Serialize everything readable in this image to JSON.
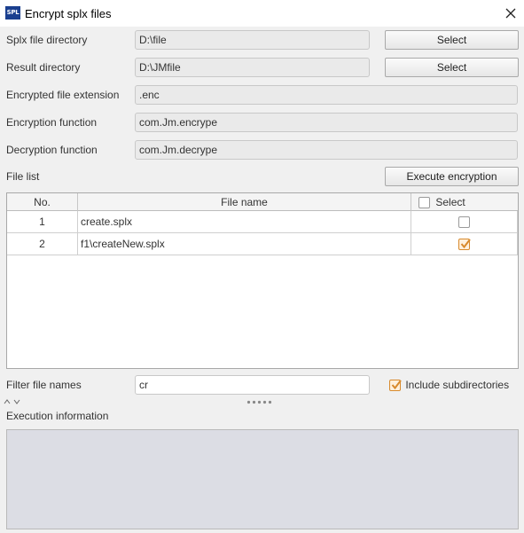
{
  "window": {
    "app_icon_text": "SPL",
    "title": "Encrypt splx files",
    "close_icon": "close-icon"
  },
  "form": {
    "splx_dir_label": "Splx file directory",
    "splx_dir_value": "D:\\file",
    "result_dir_label": "Result directory",
    "result_dir_value": "D:\\JMfile",
    "select_label": "Select",
    "ext_label": "Encrypted file extension",
    "ext_value": ".enc",
    "enc_func_label": "Encryption function",
    "enc_func_value": "com.Jm.encrype",
    "dec_func_label": "Decryption function",
    "dec_func_value": "com.Jm.decrype"
  },
  "file_list": {
    "label": "File list",
    "execute_label": "Execute encryption",
    "columns": {
      "no": "No.",
      "name": "File name",
      "select": "Select"
    },
    "rows": [
      {
        "no": "1",
        "name": "create.splx",
        "selected": false
      },
      {
        "no": "2",
        "name": "f1\\createNew.splx",
        "selected": true
      }
    ]
  },
  "filter": {
    "label": "Filter file names",
    "value": "cr",
    "include_subdirs_label": "Include subdirectories",
    "include_subdirs_checked": true
  },
  "execution": {
    "label": "Execution information",
    "text": ""
  },
  "colors": {
    "check_accent": "#d88a2c",
    "info_bg": "#dcdde4",
    "app_icon_bg": "#1a3f8f"
  }
}
